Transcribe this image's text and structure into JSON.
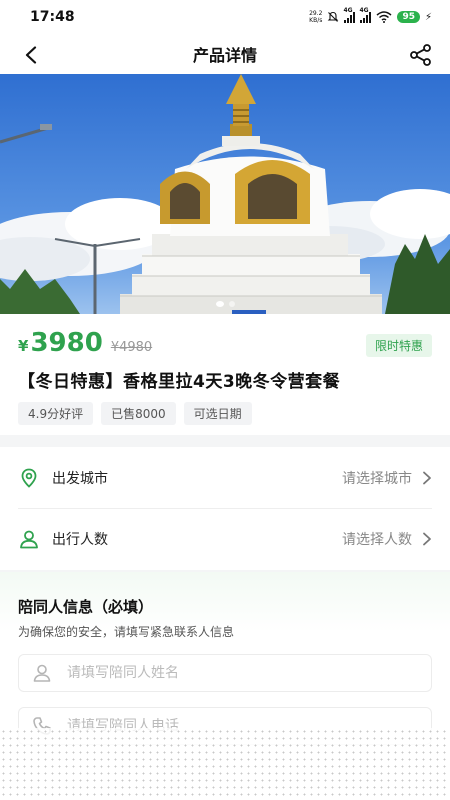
{
  "status_bar": {
    "time": "17:48",
    "net_speed_value": "29.2",
    "net_speed_unit": "KB/s",
    "signal_1_label": "4G",
    "signal_2_label": "4G",
    "battery": "95"
  },
  "nav": {
    "title": "产品详情",
    "back_icon": "chevron-left-icon",
    "share_icon": "share-icon"
  },
  "hero": {
    "slides": 2,
    "active_slide": 1
  },
  "product": {
    "currency": "¥",
    "price": "3980",
    "original_price": "¥4980",
    "promo_tag": "限时特惠",
    "title": "【冬日特惠】香格里拉4天3晚冬令营套餐",
    "tags": [
      "4.9分好评",
      "已售8000",
      "可选日期"
    ]
  },
  "options": [
    {
      "label": "出发城市",
      "value": "请选择城市",
      "icon": "location-pin-icon"
    },
    {
      "label": "出行人数",
      "value": "请选择人数",
      "icon": "person-icon"
    }
  ],
  "companion": {
    "title": "陪同人信息（必填）",
    "subtitle": "为确保您的安全，请填写紧急联系人信息",
    "name_placeholder": "请填写陪同人姓名",
    "phone_placeholder": "请填写陪同人电话"
  },
  "colors": {
    "accent": "#2fa24e",
    "tag_bg": "#e7f6ea",
    "battery": "#2bb24c"
  }
}
